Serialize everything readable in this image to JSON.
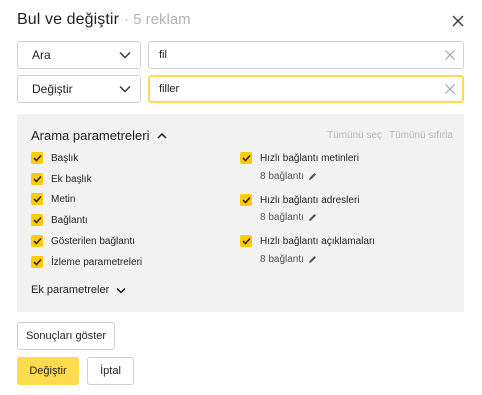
{
  "dialog": {
    "title": "Bul ve değiştir",
    "subtitle": "· 5 reklam"
  },
  "find": {
    "mode_label": "Ara",
    "value": "fil"
  },
  "replace": {
    "mode_label": "Değiştir",
    "value": "filler"
  },
  "search_params": {
    "title": "Arama parametreleri",
    "select_all": "Tümünü seç",
    "reset_all": "Tümünü sıfırla",
    "left_options": [
      {
        "label": "Başlık",
        "checked": true
      },
      {
        "label": "Ek başlık",
        "checked": true
      },
      {
        "label": "Metin",
        "checked": true
      },
      {
        "label": "Bağlantı",
        "checked": true
      },
      {
        "label": "Gösterilen bağlantı",
        "checked": true
      },
      {
        "label": "İzleme parametreleri",
        "checked": true
      }
    ],
    "right_options": [
      {
        "label": "Hızlı bağlantı metinleri",
        "checked": true,
        "sub": "8 bağlantı"
      },
      {
        "label": "Hızlı bağlantı adresleri",
        "checked": true,
        "sub": "8 bağlantı"
      },
      {
        "label": "Hızlı bağlantı açıklamaları",
        "checked": true,
        "sub": "8 bağlantı"
      }
    ],
    "extra_label": "Ek parametreler"
  },
  "actions": {
    "show_results": "Sonuçları göster",
    "replace": "Değiştir",
    "cancel": "İptal"
  },
  "colors": {
    "accent": "#ffdb4d",
    "checkbox": "#ffcc00",
    "panel_bg": "#f2f2f2",
    "muted_text": "#b7b7b7"
  }
}
